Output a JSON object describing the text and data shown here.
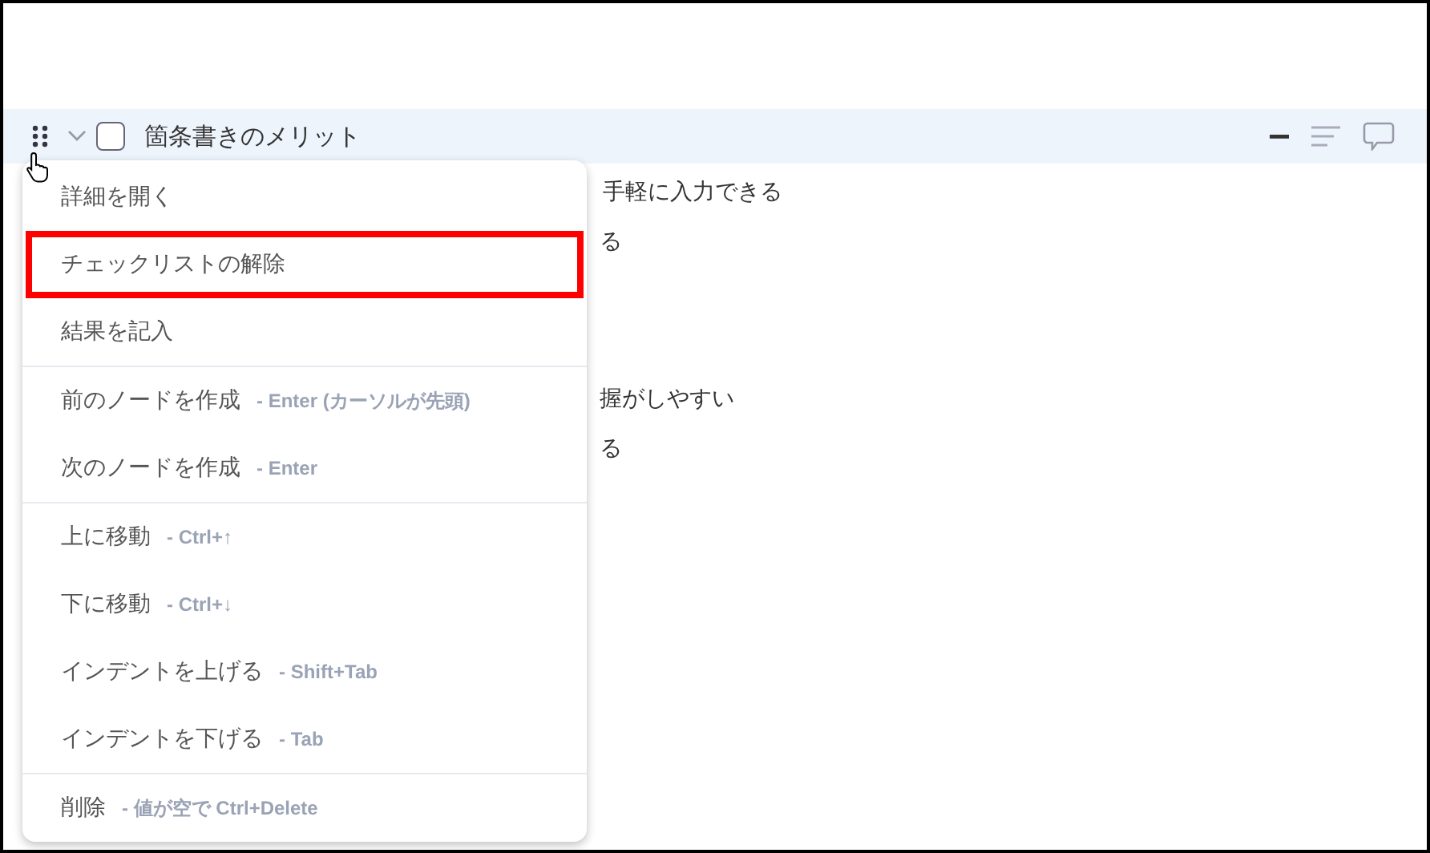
{
  "node": {
    "title": "箇条書きのメリット",
    "checked": false,
    "expanded": true
  },
  "behind_lines": [
    {
      "text": "手軽に入力できる"
    },
    {
      "text": "る"
    },
    {
      "text": "握がしやすい"
    },
    {
      "text": "る"
    }
  ],
  "context_menu": {
    "groups": [
      [
        {
          "label": "詳細を開く",
          "highlighted": false
        },
        {
          "label": "チェックリストの解除",
          "highlighted": true
        },
        {
          "label": "結果を記入",
          "highlighted": false
        }
      ],
      [
        {
          "label": "前のノードを作成",
          "shortcut": "- Enter (カーソルが先頭)",
          "highlighted": false
        },
        {
          "label": "次のノードを作成",
          "shortcut": "- Enter",
          "highlighted": false
        }
      ],
      [
        {
          "label": "上に移動",
          "shortcut": "- Ctrl+↑",
          "highlighted": false
        },
        {
          "label": "下に移動",
          "shortcut": "- Ctrl+↓",
          "highlighted": false
        },
        {
          "label": "インデントを上げる",
          "shortcut": "- Shift+Tab",
          "highlighted": false
        },
        {
          "label": "インデントを下げる",
          "shortcut": "- Tab",
          "highlighted": false
        }
      ],
      [
        {
          "label": "削除",
          "shortcut": "- 値が空で Ctrl+Delete",
          "highlighted": false
        }
      ]
    ]
  }
}
